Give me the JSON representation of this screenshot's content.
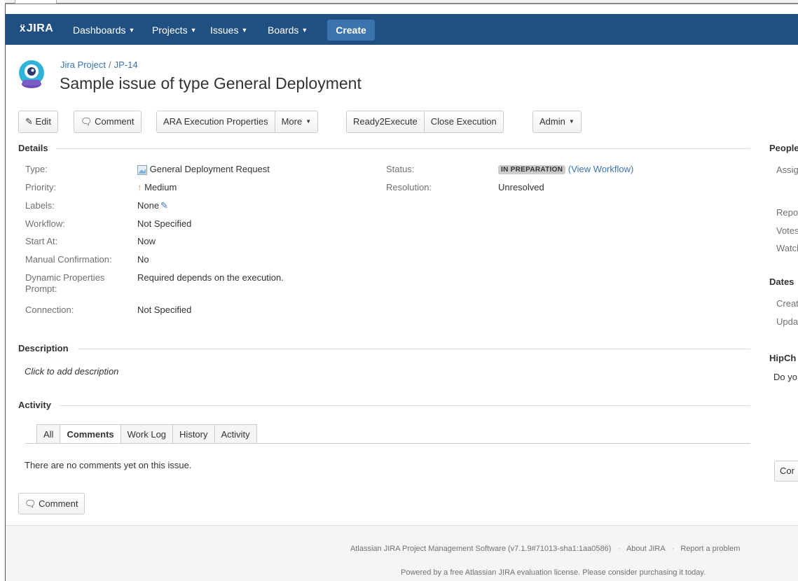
{
  "header": {
    "logo": "JIRA",
    "nav": [
      {
        "label": "Dashboards"
      },
      {
        "label": "Projects"
      },
      {
        "label": "Issues"
      },
      {
        "label": "Boards"
      }
    ],
    "create_label": "Create"
  },
  "issue": {
    "project": "Jira Project",
    "key": "JP-14",
    "title": "Sample issue of type General Deployment"
  },
  "toolbar": {
    "edit": "Edit",
    "comment": "Comment",
    "ara": "ARA Execution Properties",
    "more": "More",
    "ready": "Ready2Execute",
    "close_exec": "Close Execution",
    "admin": "Admin"
  },
  "details": {
    "heading": "Details",
    "type_label": "Type:",
    "type_value": "General Deployment Request",
    "priority_label": "Priority:",
    "priority_value": "Medium",
    "labels_label": "Labels:",
    "labels_value": "None",
    "workflow_label": "Workflow:",
    "workflow_value": "Not Specified",
    "start_label": "Start At:",
    "start_value": "Now",
    "manual_label": "Manual Confirmation:",
    "manual_value": "No",
    "dyn_label_1": "Dynamic Properties",
    "dyn_label_2": "Prompt:",
    "dyn_value": "Required depends on the execution.",
    "connection_label": "Connection:",
    "connection_value": "Not Specified",
    "status_label": "Status:",
    "status_value": "IN PREPARATION",
    "view_workflow": "(View Workflow)",
    "resolution_label": "Resolution:",
    "resolution_value": "Unresolved"
  },
  "description": {
    "heading": "Description",
    "placeholder": "Click to add description"
  },
  "activity": {
    "heading": "Activity",
    "tabs": [
      "All",
      "Comments",
      "Work Log",
      "History",
      "Activity"
    ],
    "active_tab": "Comments",
    "empty_text": "There are no comments yet on this issue.",
    "comment_button": "Comment"
  },
  "right_column": {
    "people_heading": "People",
    "assignee": "Assig",
    "reporter": "Repo",
    "votes": "Votes",
    "watchers": "Watch",
    "dates_heading": "Dates",
    "created": "Creat",
    "updated": "Upda",
    "hipchat_heading": "HipCh",
    "hipchat_text": "Do yo",
    "hipchat_button": "Cor"
  },
  "footer": {
    "software": "Atlassian JIRA Project Management Software (v7.1.9#71013-sha1:1aa0586)",
    "about": "About JIRA",
    "report": "Report a problem",
    "license": "Powered by a free Atlassian JIRA evaluation license. Please consider purchasing it today."
  },
  "colors": {
    "header_bg": "#205081",
    "create_bg": "#3b73af",
    "link": "#3b73af",
    "priority_arrow": "#f79232",
    "status_lozenge": "#cccccc"
  }
}
